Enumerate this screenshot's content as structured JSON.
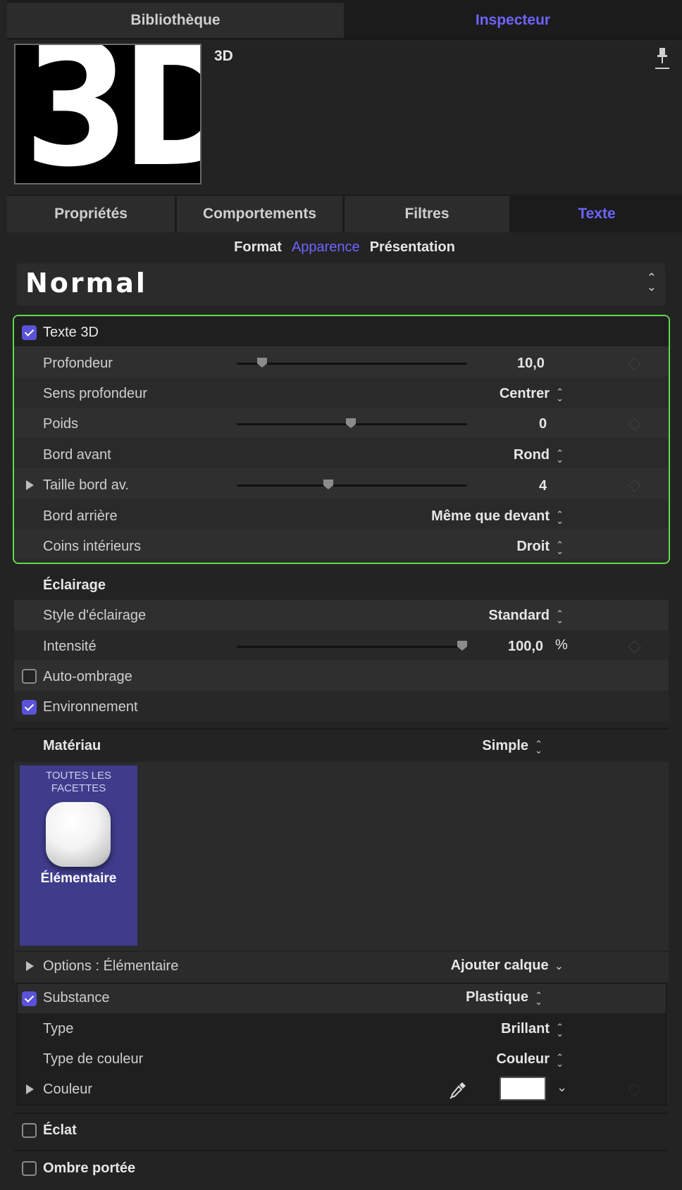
{
  "top_tabs": {
    "library": "Bibliothèque",
    "inspector": "Inspecteur"
  },
  "preview": {
    "thumb_text": "3D",
    "name": "3D"
  },
  "sub_tabs": [
    "Propriétés",
    "Comportements",
    "Filtres",
    "Texte"
  ],
  "section_tabs": [
    "Format",
    "Apparence",
    "Présentation"
  ],
  "preset": "Normal",
  "text3d": {
    "title": "Texte 3D",
    "depth": {
      "label": "Profondeur",
      "value": "10,0"
    },
    "depth_dir": {
      "label": "Sens profondeur",
      "value": "Centrer"
    },
    "weight": {
      "label": "Poids",
      "value": "0"
    },
    "front_edge": {
      "label": "Bord avant",
      "value": "Rond"
    },
    "front_edge_size": {
      "label": "Taille bord av.",
      "value": "4"
    },
    "back_edge": {
      "label": "Bord arrière",
      "value": "Même que devant"
    },
    "inner_corners": {
      "label": "Coins intérieurs",
      "value": "Droit"
    }
  },
  "lighting": {
    "title": "Éclairage",
    "style": {
      "label": "Style d'éclairage",
      "value": "Standard"
    },
    "intensity": {
      "label": "Intensité",
      "value": "100,0",
      "unit": "%"
    },
    "self_shadow": "Auto-ombrage",
    "environment": "Environnement"
  },
  "material": {
    "label": "Matériau",
    "value": "Simple",
    "card_header_1": "TOUTES LES",
    "card_header_2": "FACETTES",
    "card_label": "Élémentaire",
    "options_label": "Options : Élémentaire",
    "add_layer": "Ajouter calque",
    "substance": {
      "label": "Substance",
      "value": "Plastique"
    },
    "type": {
      "label": "Type",
      "value": "Brillant"
    },
    "color_type": {
      "label": "Type de couleur",
      "value": "Couleur"
    },
    "color": {
      "label": "Couleur",
      "swatch": "#ffffff"
    }
  },
  "glow": "Éclat",
  "drop_shadow": "Ombre portée",
  "colors": {
    "accent": "#5a53d8",
    "accent_text": "#6e64ff",
    "highlight_border": "#62d84e"
  }
}
